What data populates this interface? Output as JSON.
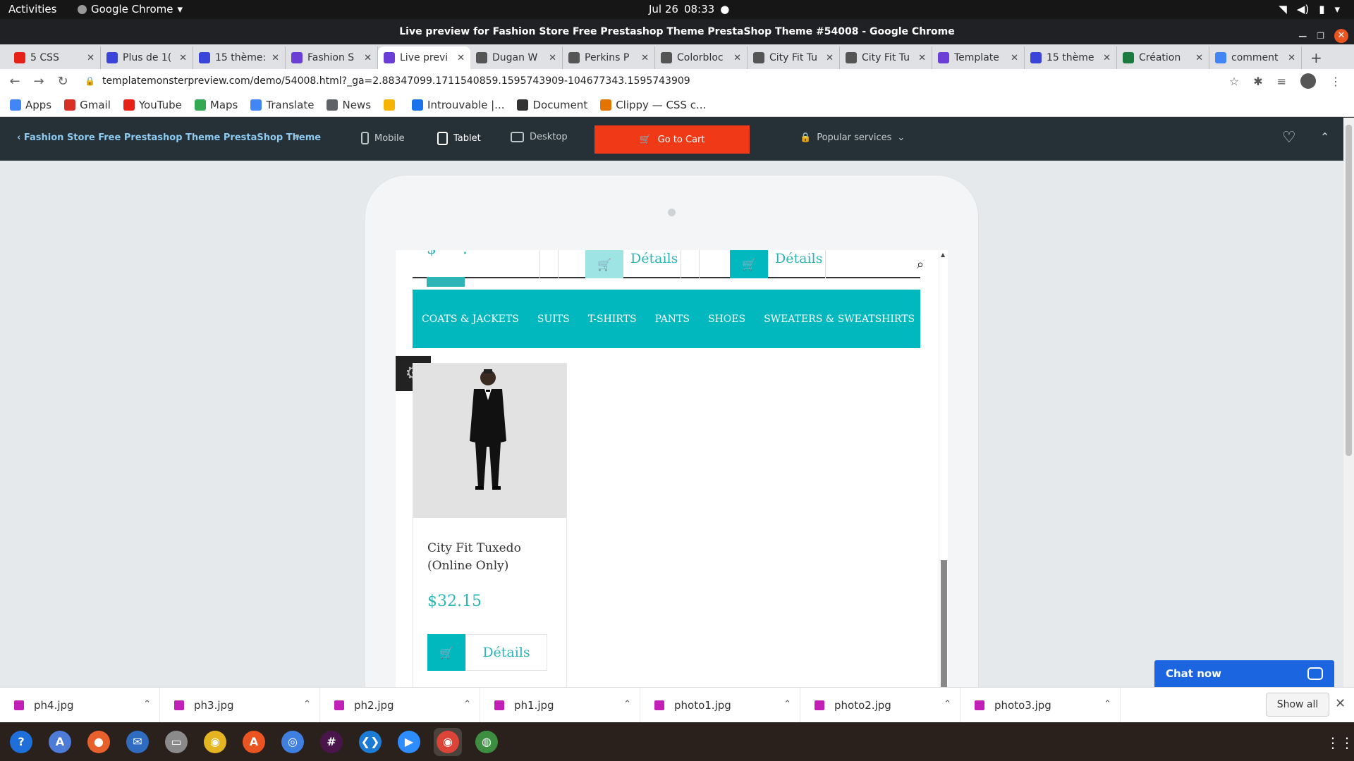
{
  "system": {
    "activities": "Activities",
    "app_name": "Google Chrome",
    "date": "Jul 26",
    "time": "08:33"
  },
  "window": {
    "title": "Live preview for Fashion Store Free Prestashop Theme PrestaShop Theme #54008 - Google Chrome"
  },
  "tabs": [
    {
      "label": "5 CSS",
      "favicon": "youtube-icon",
      "color": "#e62117"
    },
    {
      "label": "Plus de 1(",
      "favicon": "c-icon",
      "color": "#3b44d8"
    },
    {
      "label": "15 thème:",
      "favicon": "c-icon",
      "color": "#3b44d8"
    },
    {
      "label": "Fashion S",
      "favicon": "tm-icon",
      "color": "#6b3fd6"
    },
    {
      "label": "Live previ",
      "favicon": "tm-icon",
      "color": "#6b3fd6",
      "active": true
    },
    {
      "label": "Dugan W",
      "favicon": "bv-icon",
      "color": "#555"
    },
    {
      "label": "Perkins P",
      "favicon": "bv-icon",
      "color": "#555"
    },
    {
      "label": "Colorbloc",
      "favicon": "bv-icon",
      "color": "#555"
    },
    {
      "label": "City Fit Tu",
      "favicon": "bv-icon",
      "color": "#555"
    },
    {
      "label": "City Fit Tu",
      "favicon": "bv-icon",
      "color": "#555"
    },
    {
      "label": "Template",
      "favicon": "tm-icon",
      "color": "#6b3fd6"
    },
    {
      "label": "15 thème",
      "favicon": "c-icon",
      "color": "#3b44d8"
    },
    {
      "label": "Création",
      "favicon": "globe-icon",
      "color": "#1b7a3e"
    },
    {
      "label": "comment",
      "favicon": "google-icon",
      "color": "#4285f4"
    }
  ],
  "address": {
    "url": "templatemonsterpreview.com/demo/54008.html?_ga=2.88347099.1711540859.1595743909-104677343.1595743909"
  },
  "bookmarks": [
    {
      "label": "Apps",
      "icon": "apps-grid-icon",
      "color": "#4285f4"
    },
    {
      "label": "Gmail",
      "icon": "gmail-icon",
      "color": "#d93025"
    },
    {
      "label": "YouTube",
      "icon": "youtube-icon",
      "color": "#e62117"
    },
    {
      "label": "Maps",
      "icon": "maps-icon",
      "color": "#34a853"
    },
    {
      "label": "Translate",
      "icon": "translate-icon",
      "color": "#4285f4"
    },
    {
      "label": "News",
      "icon": "news-icon",
      "color": "#5f6368"
    },
    {
      "label": "",
      "icon": "drive-icon",
      "color": "#f4b400"
    },
    {
      "label": "Introuvable |...",
      "icon": "page-icon",
      "color": "#1a73e8"
    },
    {
      "label": "Document",
      "icon": "globe-icon",
      "color": "#333"
    },
    {
      "label": "Clippy — CSS c...",
      "icon": "clippy-icon",
      "color": "#e37400"
    }
  ],
  "tm_bar": {
    "title": "Fashion Store Free Prestashop Theme PrestaShop Theme",
    "devices": [
      "Mobile",
      "Tablet",
      "Desktop"
    ],
    "cart_label": "Go to Cart",
    "popular_label": "Popular services"
  },
  "store": {
    "top_details_1": "Détails",
    "top_details_2": "Détails",
    "menu": [
      "COATS & JACKETS",
      "SUITS",
      "T-SHIRTS",
      "PANTS",
      "SHOES",
      "SWEATERS & SWEATSHIRTS"
    ],
    "product": {
      "name": "City Fit Tuxedo (Online Only)",
      "price": "$32.15",
      "details": "Détails"
    }
  },
  "chat": {
    "label": "Chat now"
  },
  "downloads": {
    "files": [
      "ph4.jpg",
      "ph3.jpg",
      "ph2.jpg",
      "ph1.jpg",
      "photo1.jpg",
      "photo2.jpg",
      "photo3.jpg"
    ],
    "show_all": "Show all"
  },
  "dock": [
    {
      "name": "help-icon",
      "color": "#1e6fd9",
      "glyph": "?"
    },
    {
      "name": "translate-app-icon",
      "color": "#4c7bd8",
      "glyph": "A"
    },
    {
      "name": "firefox-icon",
      "color": "#e8612c",
      "glyph": "●"
    },
    {
      "name": "thunderbird-icon",
      "color": "#2f6bbf",
      "glyph": "✉"
    },
    {
      "name": "files-icon",
      "color": "#8a8a8a",
      "glyph": "▭"
    },
    {
      "name": "rhythmbox-icon",
      "color": "#e5b521",
      "glyph": "◉"
    },
    {
      "name": "software-icon",
      "color": "#e95420",
      "glyph": "A"
    },
    {
      "name": "chromium-icon",
      "color": "#3f7fe0",
      "glyph": "◎"
    },
    {
      "name": "slack-icon",
      "color": "#4a154b",
      "glyph": "#"
    },
    {
      "name": "vscode-icon",
      "color": "#1c7bd4",
      "glyph": "❮❯"
    },
    {
      "name": "zoom-icon",
      "color": "#2d8cff",
      "glyph": "▶"
    },
    {
      "name": "chrome-icon",
      "color": "#db4437",
      "glyph": "◉",
      "active": true
    },
    {
      "name": "globe-app-icon",
      "color": "#3e8e41",
      "glyph": "◍"
    }
  ]
}
